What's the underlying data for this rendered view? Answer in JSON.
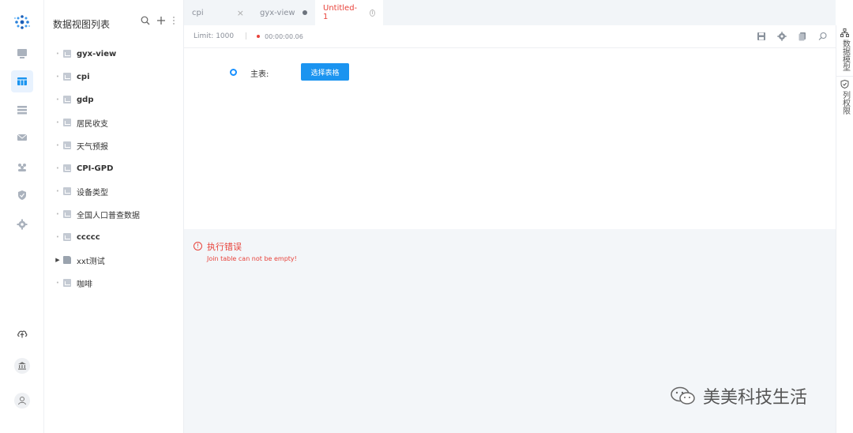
{
  "sidebar": {
    "rail_icons": [
      {
        "name": "dashboard-icon"
      },
      {
        "name": "dataview-icon"
      },
      {
        "name": "dataset-icon"
      },
      {
        "name": "message-icon"
      },
      {
        "name": "users-icon"
      },
      {
        "name": "shield-icon"
      },
      {
        "name": "gear-icon"
      }
    ],
    "bottom_icons": [
      {
        "name": "cloud-upload-icon"
      },
      {
        "name": "bank-icon"
      },
      {
        "name": "user-icon"
      }
    ]
  },
  "panel": {
    "title": "数据视图列表",
    "items": [
      {
        "label": "gyx-view",
        "type": "view"
      },
      {
        "label": "cpi",
        "type": "view"
      },
      {
        "label": "gdp",
        "type": "view"
      },
      {
        "label": "居民收支",
        "type": "view"
      },
      {
        "label": "天气预报",
        "type": "view"
      },
      {
        "label": "CPI-GPD",
        "type": "view"
      },
      {
        "label": "设备类型",
        "type": "view"
      },
      {
        "label": "全国人口普查数据",
        "type": "view"
      },
      {
        "label": "ccccc",
        "type": "view"
      },
      {
        "label": "xxt测试",
        "type": "folder"
      },
      {
        "label": "咖啡",
        "type": "view"
      }
    ]
  },
  "tabs": [
    {
      "label": "cpi"
    },
    {
      "label": "gyx-view"
    },
    {
      "label": "Untitled-1"
    }
  ],
  "toolbar": {
    "limit": "Limit: 1000",
    "separator": "|",
    "timer": "00:00:00.06"
  },
  "editor": {
    "main_table_label": "主表:",
    "select_button": "选择表格"
  },
  "result": {
    "error_title": "执行错误",
    "error_message": "Join table can not be empty!"
  },
  "right_panel": {
    "items": [
      {
        "label": "数据模型",
        "icon": "data-model-icon"
      },
      {
        "label": "列权限",
        "icon": "column-permission-icon"
      }
    ]
  },
  "watermark": {
    "text": "美美科技生活"
  },
  "colors": {
    "primary": "#1b94f0",
    "error": "#e8433b",
    "active_tab": "#e8433b"
  }
}
